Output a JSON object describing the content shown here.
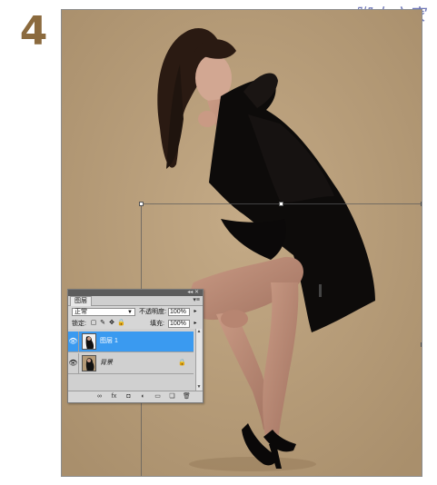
{
  "step": {
    "number": "4"
  },
  "watermark": {
    "text": "脚本之家"
  },
  "colors": {
    "backdrop": "#b59b78",
    "selection": "#3a9af0",
    "step_number": "#8b6a3e",
    "watermark": "#6f78b8"
  },
  "layers_panel": {
    "tab_label": "图层",
    "blend_mode": "正常",
    "opacity_label": "不透明度:",
    "opacity_value": "100%",
    "lock_label": "锁定:",
    "fill_label": "填充:",
    "fill_value": "100%",
    "layers": [
      {
        "name": "图层 1",
        "visible": true,
        "selected": true
      },
      {
        "name": "背景",
        "visible": true,
        "selected": false,
        "locked": true
      }
    ],
    "bottom_icons": [
      "link-icon",
      "fx-icon",
      "mask-icon",
      "adjustment-icon",
      "group-icon",
      "new-layer-icon",
      "trash-icon"
    ]
  }
}
